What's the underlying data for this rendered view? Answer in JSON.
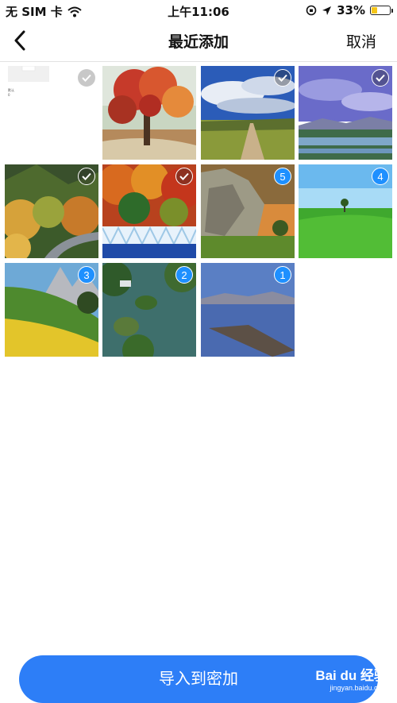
{
  "status_bar": {
    "carrier": "无 SIM 卡",
    "time": "上午11:06",
    "battery": "33%",
    "battery_level": 0.33
  },
  "nav": {
    "title": "最近添加",
    "cancel_label": "取消"
  },
  "photos": [
    {
      "selected": true,
      "badge": "✓",
      "style": "grey",
      "note_title": "默认",
      "note_sub": "0"
    },
    {
      "selected": false,
      "badge": ""
    },
    {
      "selected": true,
      "badge": "✓"
    },
    {
      "selected": true,
      "badge": "✓"
    },
    {
      "selected": true,
      "badge": "✓"
    },
    {
      "selected": true,
      "badge": "✓"
    },
    {
      "selected": true,
      "badge": "5"
    },
    {
      "selected": true,
      "badge": "4"
    },
    {
      "selected": true,
      "badge": "3"
    },
    {
      "selected": true,
      "badge": "2"
    },
    {
      "selected": true,
      "badge": "1"
    }
  ],
  "bottom": {
    "import_label": "导入到密加",
    "watermark_brand": "Bai du 经验",
    "watermark_url": "jingyan.baidu.com"
  },
  "colors": {
    "accent": "#2d7ef7",
    "badge_blue": "#1e90ff",
    "battery": "#f5c518"
  }
}
